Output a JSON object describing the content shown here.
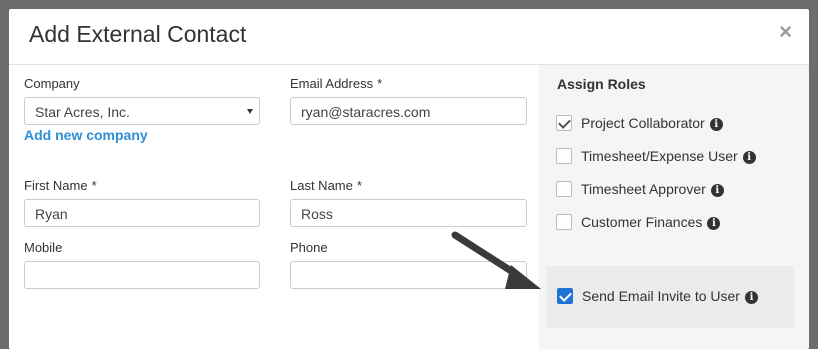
{
  "modal": {
    "title": "Add External Contact",
    "close_glyph": "×"
  },
  "form": {
    "company": {
      "label": "Company",
      "value": "Star Acres, Inc."
    },
    "add_company_link": "Add new company",
    "email": {
      "label": "Email Address",
      "required_mark": "*",
      "value": "ryan@staracres.com"
    },
    "first_name": {
      "label": "First Name",
      "required_mark": "*",
      "value": "Ryan"
    },
    "last_name": {
      "label": "Last Name",
      "required_mark": "*",
      "value": "Ross"
    },
    "mobile": {
      "label": "Mobile",
      "value": ""
    },
    "phone": {
      "label": "Phone",
      "value": ""
    }
  },
  "roles": {
    "title": "Assign Roles",
    "items": [
      {
        "label": "Project Collaborator",
        "checked": true
      },
      {
        "label": "Timesheet/Expense User",
        "checked": false
      },
      {
        "label": "Timesheet Approver",
        "checked": false
      },
      {
        "label": "Customer Finances",
        "checked": false
      }
    ],
    "send_invite": {
      "label": "Send Email Invite to User",
      "checked": true
    }
  },
  "icons": {
    "info": "info-icon",
    "close": "close-icon",
    "caret": "chevron-down-icon",
    "arrow": "pointer-arrow-icon"
  },
  "colors": {
    "accent": "#1e73d8",
    "link": "#2d8fd6",
    "overlay": "#6d6d6d"
  }
}
